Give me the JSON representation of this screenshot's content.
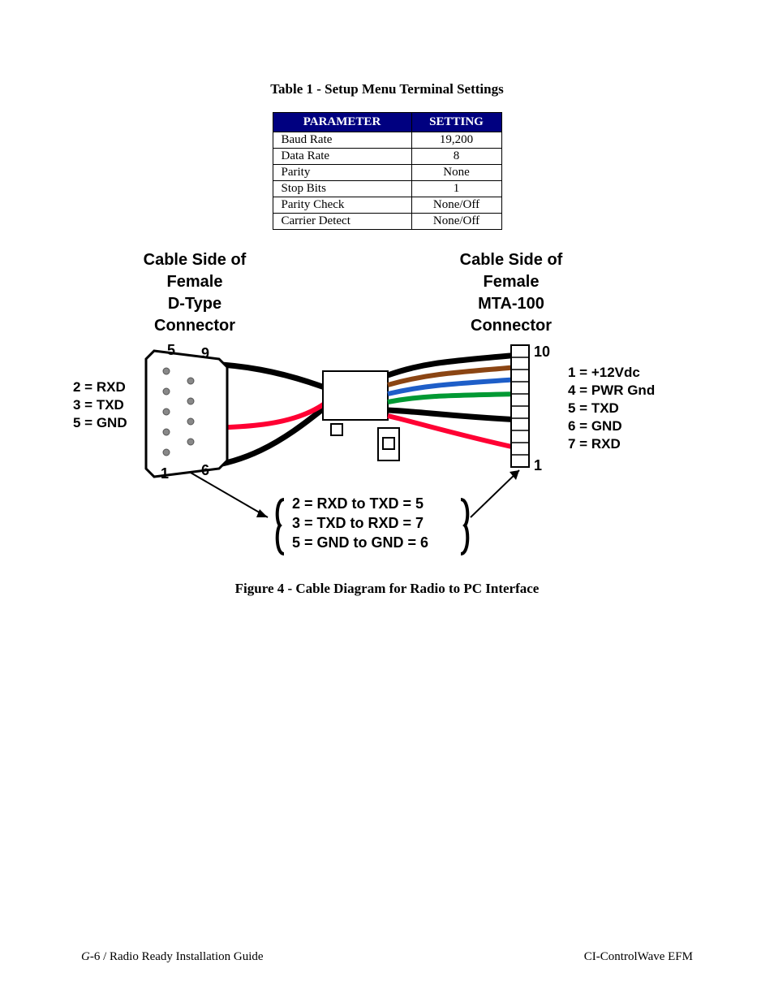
{
  "table": {
    "caption": "Table 1 - Setup Menu Terminal Settings",
    "headers": {
      "param": "PARAMETER",
      "setting": "SETTING"
    },
    "rows": [
      {
        "param": "Baud Rate",
        "setting": "19,200"
      },
      {
        "param": "Data Rate",
        "setting": "8"
      },
      {
        "param": "Parity",
        "setting": "None"
      },
      {
        "param": "Stop Bits",
        "setting": "1"
      },
      {
        "param": "Parity Check",
        "setting": "None/Off"
      },
      {
        "param": "Carrier Detect",
        "setting": "None/Off"
      }
    ]
  },
  "diagram": {
    "left_header": [
      "Cable Side of",
      "Female",
      "D-Type",
      "Connector"
    ],
    "right_header": [
      "Cable Side of",
      "Female",
      "MTA-100",
      "Connector"
    ],
    "left_pins": [
      "2 = RXD",
      "3 = TXD",
      "5 = GND"
    ],
    "right_pins": [
      "1 = +12Vdc",
      "4 = PWR Gnd",
      "5 = TXD",
      "6 = GND",
      "7 = RXD"
    ],
    "pin_nums": {
      "l_top": "5",
      "l_top2": "9",
      "l_bot": "1",
      "l_bot2": "6",
      "r_top": "10",
      "r_bot": "1"
    },
    "mappings": [
      "2 = RXD to TXD = 5",
      "3 = TXD to RXD = 7",
      "5 = GND to GND = 6"
    ]
  },
  "figure_caption": "Figure 4 - Cable Diagram for Radio to PC Interface",
  "footer": {
    "left_prefix": "G-",
    "left_page": "6",
    "left_title": " / Radio Ready Installation Guide",
    "right": "CI-ControlWave EFM"
  },
  "colors": {
    "wire_black": "#000000",
    "wire_brown": "#8b4513",
    "wire_blue": "#1e5ec8",
    "wire_green": "#009933",
    "wire_red": "#ff0033",
    "conn_fill": "#ffffff",
    "conn_stroke": "#000000"
  }
}
